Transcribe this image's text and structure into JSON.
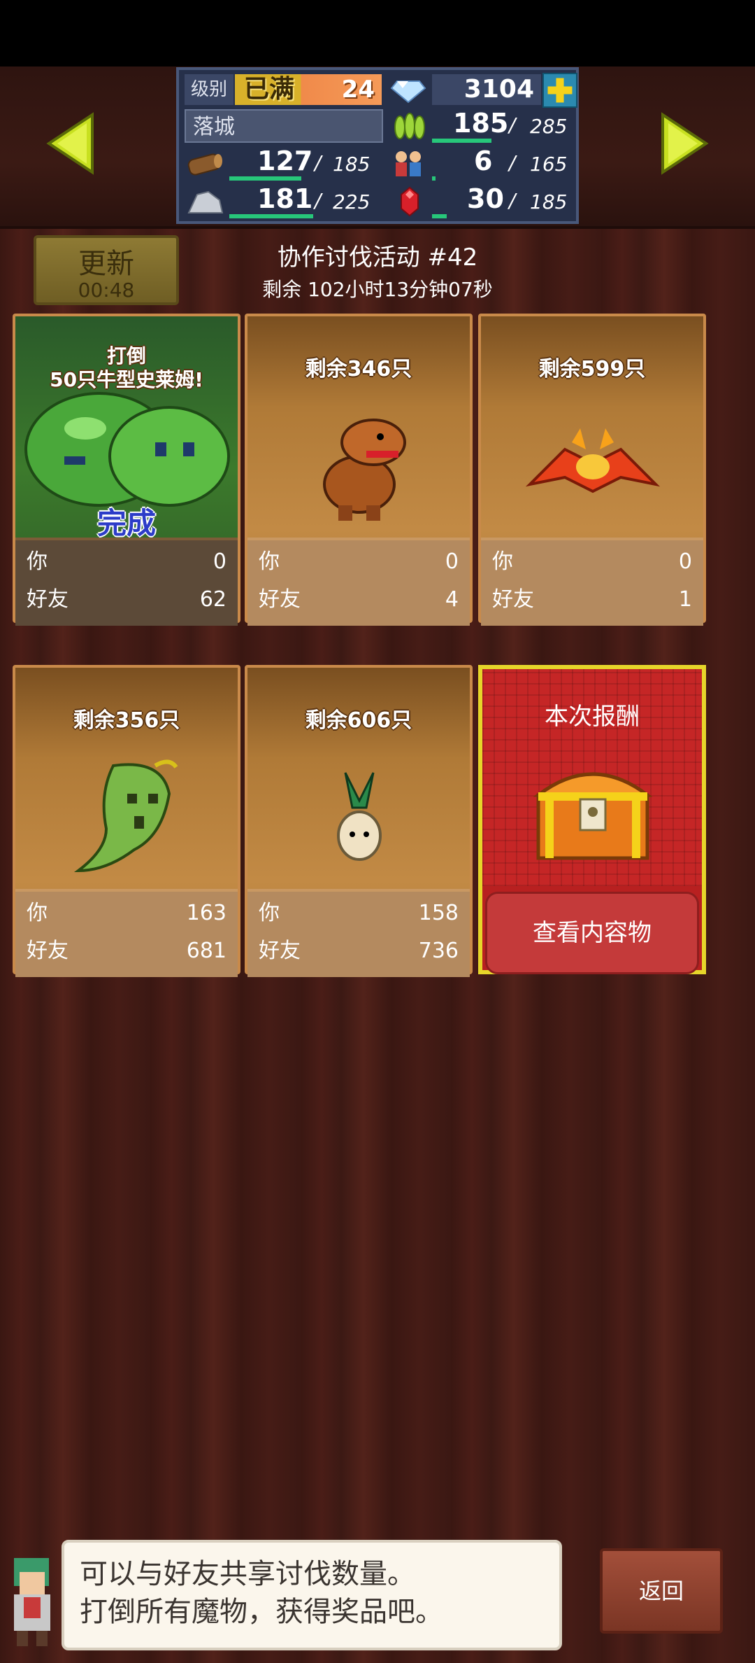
{
  "hud": {
    "level_label": "级别",
    "level_max_badge": "已满",
    "level_value": "24",
    "gems": "3104",
    "city_name": "落城",
    "wood": {
      "current": "127",
      "max": "185",
      "fraction": 0.69
    },
    "food": {
      "current": "185",
      "max": "285",
      "fraction": 0.65
    },
    "stone": {
      "current": "181",
      "max": "225",
      "fraction": 0.8
    },
    "residents": {
      "current": "6",
      "max": "165",
      "fraction": 0.04
    },
    "ruby": {
      "current": "30",
      "max": "185",
      "fraction": 0.16
    }
  },
  "event": {
    "update_label": "更新",
    "update_timer": "00:48",
    "title": "协作讨伐活动 #42",
    "remaining": "剩余 102小时13分钟07秒"
  },
  "labels": {
    "you": "你",
    "friends": "好友"
  },
  "cards": [
    {
      "name_line1": "打倒",
      "name_line2": "50只牛型史莱姆!",
      "status": "完成",
      "you": "0",
      "friends": "62",
      "monster": "slime-icon"
    },
    {
      "name": "剩余346只",
      "you": "0",
      "friends": "4",
      "monster": "lizard-monster-icon"
    },
    {
      "name": "剩余599只",
      "you": "0",
      "friends": "1",
      "monster": "fire-bat-icon"
    },
    {
      "name": "剩余356只",
      "you": "163",
      "friends": "681",
      "monster": "leaf-ghost-icon"
    },
    {
      "name": "剩余606只",
      "you": "158",
      "friends": "736",
      "monster": "radish-monster-icon"
    }
  ],
  "reward": {
    "title": "本次报酬",
    "button": "查看内容物"
  },
  "bottom": {
    "message_line1": "可以与好友共享讨伐数量。",
    "message_line2": "打倒所有魔物，获得奖品吧。",
    "back_button": "返回"
  },
  "colors": {
    "accent_green": "#27c77a",
    "nav_arrow": "#c8e020",
    "reward_red": "#c52626",
    "reward_border": "#e6d62a"
  }
}
